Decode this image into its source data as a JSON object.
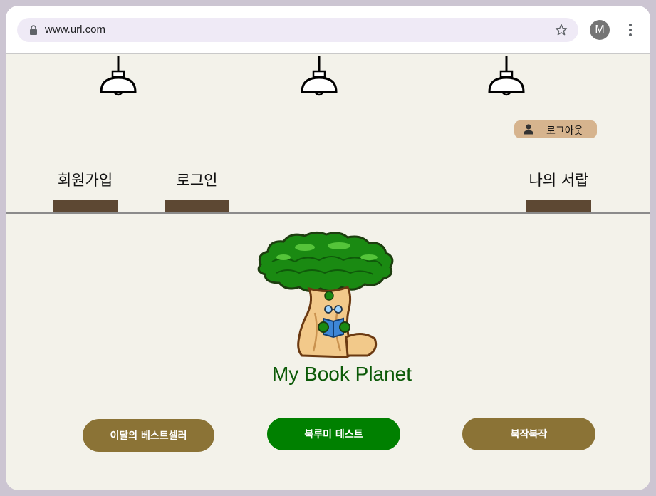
{
  "browser": {
    "url": "www.url.com",
    "profile_initial": "M"
  },
  "header": {
    "logout_label": "로그아웃",
    "nav": {
      "signup": "회원가입",
      "login": "로그인",
      "my_bookshelf": "나의 서랍"
    }
  },
  "hero": {
    "brand_name": "My Book Planet"
  },
  "actions": {
    "bestseller": "이달의 베스트셀러",
    "bookrumi_test": "북루미 테스트",
    "bookjak": "북작북작"
  },
  "colors": {
    "page_bg": "#f3f2ea",
    "nav_bar": "#5d4833",
    "logout_bg": "#d6b48e",
    "brand_text": "#0c5a08",
    "bestseller_btn": "#8b7336",
    "test_btn": "#008000",
    "bookjak_btn": "#8b7336"
  },
  "icons": [
    "lock-icon",
    "star-icon",
    "more-vert-icon",
    "lamp-icon",
    "user-icon",
    "tree-mascot"
  ]
}
